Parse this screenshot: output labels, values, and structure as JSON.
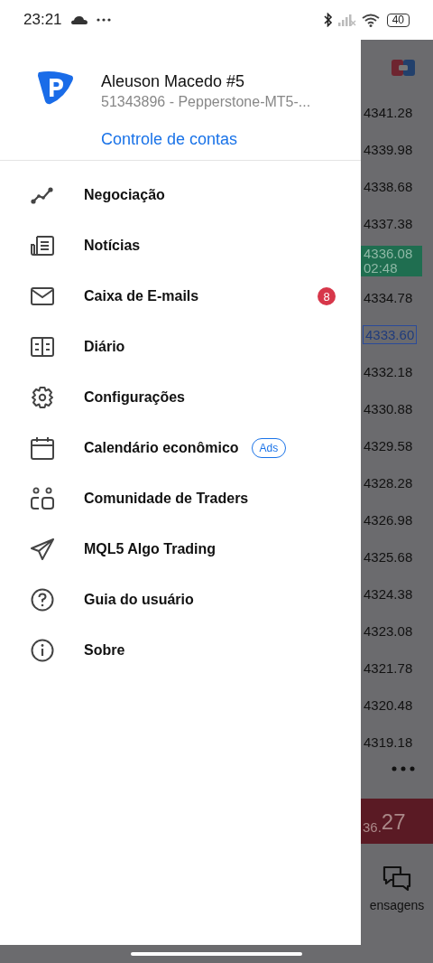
{
  "status_bar": {
    "time": "23:21",
    "battery": "40"
  },
  "account": {
    "name": "Aleuson Macedo #5",
    "server": "51343896 - Pepperstone-MT5-...",
    "link": "Controle de contas"
  },
  "menu": [
    {
      "kind": "trading",
      "label": "Negociação"
    },
    {
      "kind": "news",
      "label": "Notícias"
    },
    {
      "kind": "mail",
      "label": "Caixa de E-mails",
      "badge": "8"
    },
    {
      "kind": "journal",
      "label": "Diário"
    },
    {
      "kind": "settings",
      "label": "Configurações"
    },
    {
      "kind": "calendar",
      "label": "Calendário econômico",
      "tag": "Ads"
    },
    {
      "kind": "community",
      "label": "Comunidade de Traders"
    },
    {
      "kind": "send",
      "label": "MQL5 Algo Trading"
    },
    {
      "kind": "help",
      "label": "Guia do usuário"
    },
    {
      "kind": "info",
      "label": "Sobre"
    }
  ],
  "background": {
    "prices": [
      {
        "kind": "plain",
        "value": "4341.28"
      },
      {
        "kind": "plain",
        "value": "4339.98"
      },
      {
        "kind": "plain",
        "value": "4338.68"
      },
      {
        "kind": "plain",
        "value": "4337.38"
      },
      {
        "kind": "current",
        "value": "4336.08",
        "time": "02:48"
      },
      {
        "kind": "plain",
        "value": "4334.78"
      },
      {
        "kind": "ask",
        "value": "4333.60"
      },
      {
        "kind": "plain",
        "value": "4332.18"
      },
      {
        "kind": "plain",
        "value": "4330.88"
      },
      {
        "kind": "plain",
        "value": "4329.58"
      },
      {
        "kind": "plain",
        "value": "4328.28"
      },
      {
        "kind": "plain",
        "value": "4326.98"
      },
      {
        "kind": "plain",
        "value": "4325.68"
      },
      {
        "kind": "plain",
        "value": "4324.38"
      },
      {
        "kind": "plain",
        "value": "4323.08"
      },
      {
        "kind": "plain",
        "value": "4321.78"
      },
      {
        "kind": "plain",
        "value": "4320.48"
      },
      {
        "kind": "plain",
        "value": "4319.18"
      }
    ],
    "price_big": "36.",
    "price_small": "27",
    "tab": "ensagens"
  }
}
